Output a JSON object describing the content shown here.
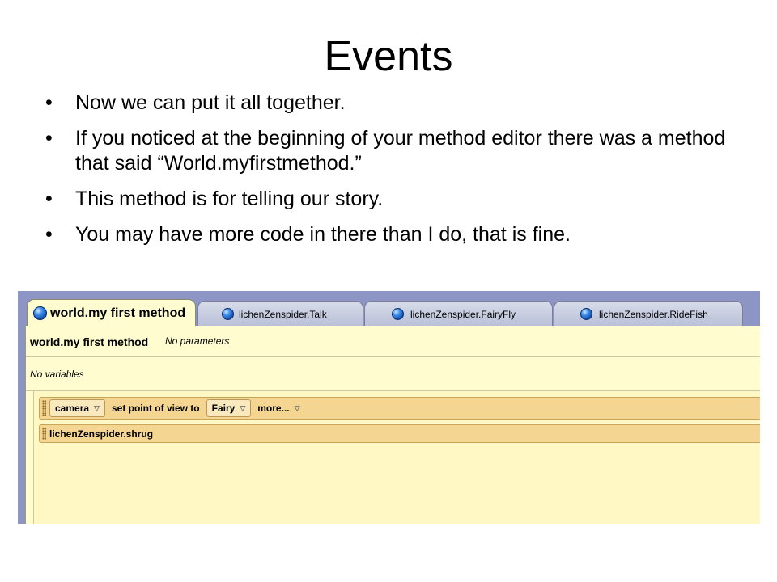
{
  "slide": {
    "title": "Events",
    "bullets": [
      "Now we can put it all together.",
      "If you noticed at the beginning of your method editor there was a method that said “World.myfirstmethod.”",
      "This method is for telling our story.",
      "You may have more code in there than I do, that is fine."
    ],
    "bullet_glyph": "•"
  },
  "editor": {
    "tabs": [
      {
        "label": "world.my first method",
        "active": true
      },
      {
        "label": "lichenZenspider.Talk",
        "active": false
      },
      {
        "label": "lichenZenspider.FairyFly",
        "active": false
      },
      {
        "label": "lichenZenspider.RideFish",
        "active": false
      }
    ],
    "method_name": "world.my first method",
    "params_text": "No parameters",
    "vars_text": "No variables",
    "statements": [
      {
        "object": "camera",
        "action": "set point of view to",
        "target": "Fairy",
        "more": "more..."
      },
      {
        "text": "lichenZenspider.shrug"
      }
    ],
    "dropdown_glyph": "▽"
  }
}
